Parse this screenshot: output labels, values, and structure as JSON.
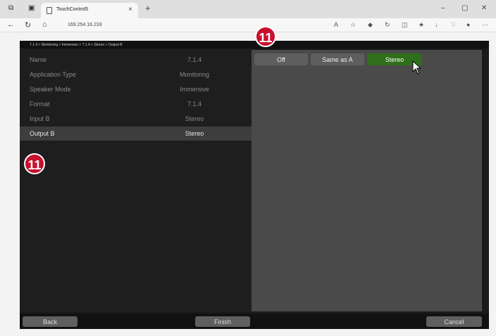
{
  "browser": {
    "tab_title": "TouchControl5",
    "tab_close": "×",
    "new_tab": "+",
    "address": "169.254.16.233",
    "win_min": "–",
    "win_max": "▢",
    "win_close": "✕",
    "nav_back": "←",
    "nav_reload": "↻",
    "nav_home": "⌂",
    "more": "···"
  },
  "app": {
    "breadcrumb": "7.1.4 > Monitoring > Immersive > 7.1.4 > Stereo > Output B",
    "rows": [
      {
        "label": "Name",
        "value": "7.1.4"
      },
      {
        "label": "Application Type",
        "value": "Monitoring"
      },
      {
        "label": "Speaker Mode",
        "value": "Immersive"
      },
      {
        "label": "Format",
        "value": "7.1.4"
      },
      {
        "label": "Input B",
        "value": "Stereo"
      },
      {
        "label": "Output B",
        "value": "Stereo"
      }
    ],
    "options": [
      {
        "label": "Off"
      },
      {
        "label": "Same as A"
      },
      {
        "label": "Stereo"
      }
    ],
    "selected_option": "Stereo",
    "bottom": {
      "back": "Back",
      "finish": "Finish",
      "cancel": "Cancel"
    }
  },
  "callouts": {
    "top": "11",
    "left": "11"
  },
  "colors": {
    "active_option": "#2f6e1a",
    "badge": "#c8102e"
  }
}
